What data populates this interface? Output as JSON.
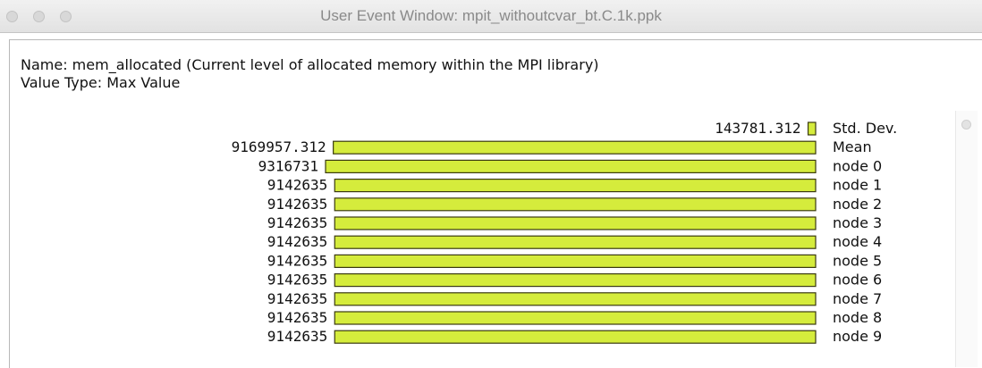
{
  "window": {
    "title": "User Event Window: mpit_withoutcvar_bt.C.1k.ppk"
  },
  "info": {
    "name_line": "Name: mem_allocated (Current level of allocated memory within the MPI library)",
    "value_type_line": "Value Type: Max Value"
  },
  "colors": {
    "bar_fill": "#d5ec3c",
    "bar_stroke": "#3a3a10"
  },
  "chart_data": {
    "type": "bar",
    "orientation": "horizontal",
    "title": "",
    "xlabel": "",
    "ylabel": "",
    "rows": [
      {
        "label": "Std. Dev.",
        "value": 143781.312,
        "value_text": "143781.312"
      },
      {
        "label": "Mean",
        "value": 9169957.312,
        "value_text": "9169957.312"
      },
      {
        "label": "node 0",
        "value": 9316731,
        "value_text": "9316731"
      },
      {
        "label": "node 1",
        "value": 9142635,
        "value_text": "9142635"
      },
      {
        "label": "node 2",
        "value": 9142635,
        "value_text": "9142635"
      },
      {
        "label": "node 3",
        "value": 9142635,
        "value_text": "9142635"
      },
      {
        "label": "node 4",
        "value": 9142635,
        "value_text": "9142635"
      },
      {
        "label": "node 5",
        "value": 9142635,
        "value_text": "9142635"
      },
      {
        "label": "node 6",
        "value": 9142635,
        "value_text": "9142635"
      },
      {
        "label": "node 7",
        "value": 9142635,
        "value_text": "9142635"
      },
      {
        "label": "node 8",
        "value": 9142635,
        "value_text": "9142635"
      },
      {
        "label": "node 9",
        "value": 9142635,
        "value_text": "9142635"
      }
    ]
  },
  "icons": {
    "close": "close-icon",
    "minimize": "minimize-icon",
    "zoom": "zoom-icon",
    "scroll": "scroll-thumb-icon"
  }
}
